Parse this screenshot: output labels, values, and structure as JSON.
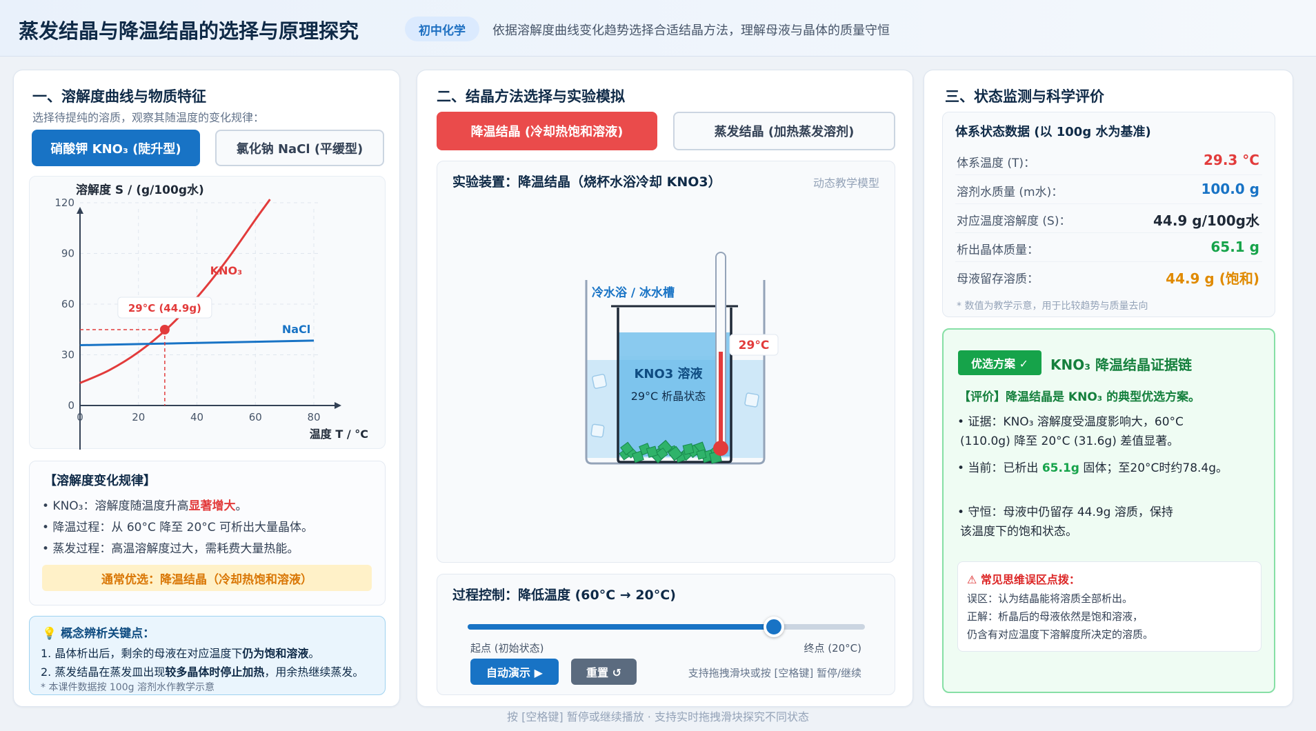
{
  "header": {
    "title": "蒸发结晶与降温结晶的选择与原理探究",
    "badge": "初中化学",
    "description": "依据溶解度曲线变化趋势选择合适结晶方法，理解母液与晶体的质量守恒"
  },
  "panel1": {
    "title": "一、溶解度曲线与物质特征",
    "prompt": "选择待提纯的溶质，观察其随温度的变化规律：",
    "btn_kno3": "硝酸钾 KNO₃ (陡升型)",
    "btn_nacl": "氯化钠 NaCl (平缓型)",
    "rules_title": "【溶解度变化规律】",
    "rule1_prefix": "• KNO₃：溶解度随温度升高",
    "rule1_highlight": "显著增大",
    "rule1_suffix": "。",
    "rule2": "• 降温过程：从 60°C 降至 20°C 可析出大量晶体。",
    "rule3": "• 蒸发过程：高温溶解度过大，需耗费大量热能。",
    "recommend": "通常优选：降温结晶（冷却热饱和溶液）",
    "concept_title": "💡 概念辨析关键点：",
    "concept1_prefix": "1. 晶体析出后，剩余的母液在对应温度下",
    "concept1_bold": "仍为饱和溶液",
    "concept1_suffix": "。",
    "concept2_prefix": "2. 蒸发结晶在蒸发皿出现",
    "concept2_bold": "较多晶体时停止加热",
    "concept2_suffix": "，用余热继续蒸发。",
    "concept_note": "* 本课件数据按 100g 溶剂水作教学示意"
  },
  "chart_data": {
    "type": "line",
    "ylabel": "溶解度 S / (g/100g水)",
    "xlabel": "温度 T / °C",
    "xlim": [
      0,
      80
    ],
    "ylim": [
      0,
      120
    ],
    "x_ticks": [
      "0",
      "20",
      "40",
      "60",
      "80"
    ],
    "y_ticks": [
      "0",
      "30",
      "60",
      "90",
      "120"
    ],
    "grid": true,
    "series": [
      {
        "name": "KNO₃",
        "color": "#e23b3b",
        "x": [
          0,
          10,
          20,
          30,
          40,
          50,
          60,
          65
        ],
        "y": [
          13.3,
          20.9,
          31.6,
          45.8,
          63.9,
          85.5,
          110,
          122
        ]
      },
      {
        "name": "NaCl",
        "color": "#1873c5",
        "x": [
          0,
          80
        ],
        "y": [
          35.7,
          38.4
        ]
      }
    ],
    "marker": {
      "x": 29,
      "y": 44.9,
      "label": "29°C (44.9g)"
    }
  },
  "panel2": {
    "title": "二、结晶方法选择与实验模拟",
    "btn_cool": "降温结晶 (冷却热饱和溶液)",
    "btn_evap": "蒸发结晶 (加热蒸发溶剂)",
    "apparatus_title": "实验装置：降温结晶（烧杯水浴冷却 KNO3）",
    "apparatus_tag": "动态教学模型",
    "bath_label": "冷水浴 / 冰水槽",
    "solution_label": "KNO3 溶液",
    "state_label": "29°C 析晶状态",
    "thermo_label": "29°C",
    "control_title": "过程控制：降低温度 (60°C → 20°C)",
    "slider_progress": 0.77,
    "slider_start": "起点 (初始状态)",
    "slider_end": "终点 (20°C)",
    "btn_auto": "自动演示 ▶",
    "btn_reset": "重置 ↺",
    "control_hint": "支持拖拽滑块或按 [空格键] 暂停/继续"
  },
  "panel3": {
    "title": "三、状态监测与科学评价",
    "state_title": "体系状态数据 (以 100g 水为基准)",
    "rows": [
      {
        "label": "体系温度 (T)：",
        "value": "29.3 °C",
        "color": "#e23b3b"
      },
      {
        "label": "溶剂水质量 (m水)：",
        "value": "100.0 g",
        "color": "#1873c5"
      },
      {
        "label": "对应温度溶解度 (S)：",
        "value": "44.9 g/100g水",
        "color": "#1f2937"
      },
      {
        "label": "析出晶体质量：",
        "value": "65.1 g",
        "color": "#16a34a"
      },
      {
        "label": "母液留存溶质：",
        "value": "44.9 g (饱和)",
        "color": "#e08a00"
      }
    ],
    "state_note": "* 数值为教学示意，用于比较趋势与质量去向",
    "eval_badge": "优选方案 ✓",
    "eval_title": "KNO₃ 降温结晶证据链",
    "eval_verdict": "【评价】降温结晶是 KNO₃ 的典型优选方案。",
    "evidence1_line1": "• 证据：KNO₃ 溶解度受温度影响大，60°C",
    "evidence1_line2": "(110.0g) 降至 20°C (31.6g) 差值显著。",
    "current_prefix": "• 当前：已析出 ",
    "current_value": "65.1g",
    "current_suffix": " 固体；至20°C时约78.4g。",
    "conserve_line1": "• 守恒：母液中仍留存 44.9g 溶质，保持",
    "conserve_line2": "该温度下的饱和状态。",
    "misc_title": "⚠ 常见思维误区点拨：",
    "misc1": "误区：认为结晶能将溶质全部析出。",
    "misc2": "正解：析晶后的母液依然是饱和溶液，",
    "misc3": "仍含有对应温度下溶解度所决定的溶质。"
  },
  "footer": "按 [空格键] 暂停或继续播放 · 支持实时拖拽滑块探究不同状态"
}
